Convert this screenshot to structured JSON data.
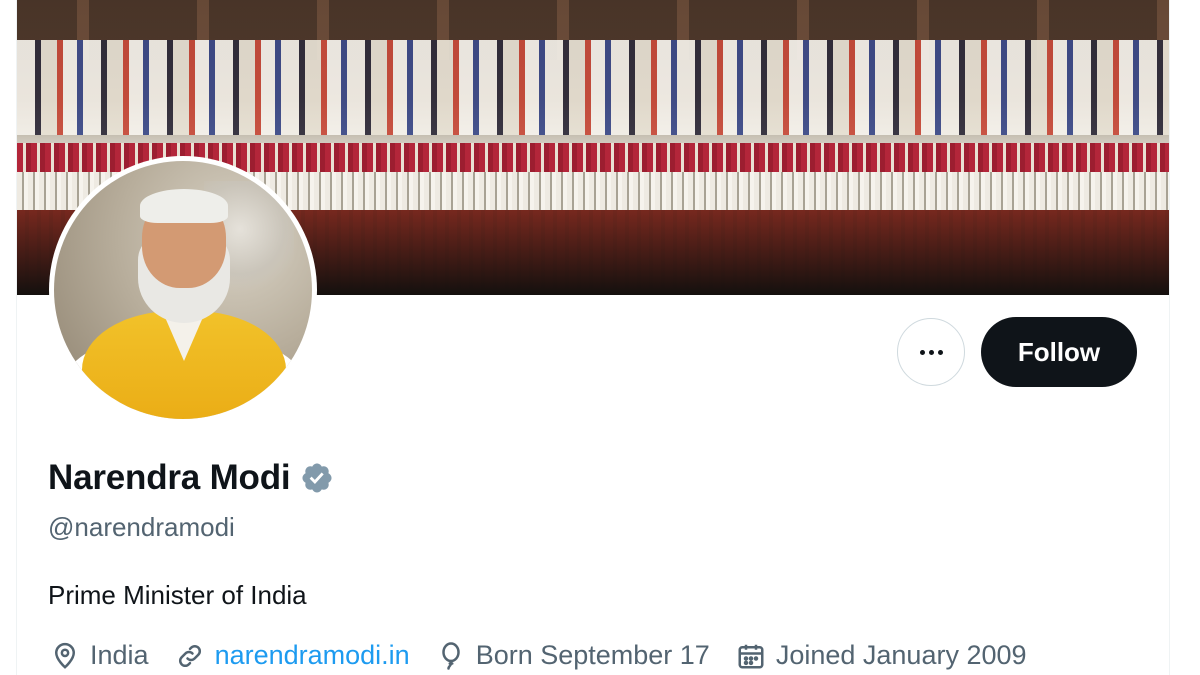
{
  "profile": {
    "display_name": "Narendra Modi",
    "handle": "@narendramodi",
    "bio": "Prime Minister of India",
    "verified_icon": "verified-badge-icon",
    "verified_color": "#829aab"
  },
  "actions": {
    "more_icon": "more-dots-icon",
    "follow_label": "Follow"
  },
  "meta": {
    "location": "India",
    "website": "narendramodi.in",
    "birthday": "Born September 17",
    "joined": "Joined January 2009"
  },
  "colors": {
    "text_primary": "#0f1419",
    "text_secondary": "#536471",
    "link": "#1d9bf0",
    "follow_bg": "#0f1419"
  }
}
